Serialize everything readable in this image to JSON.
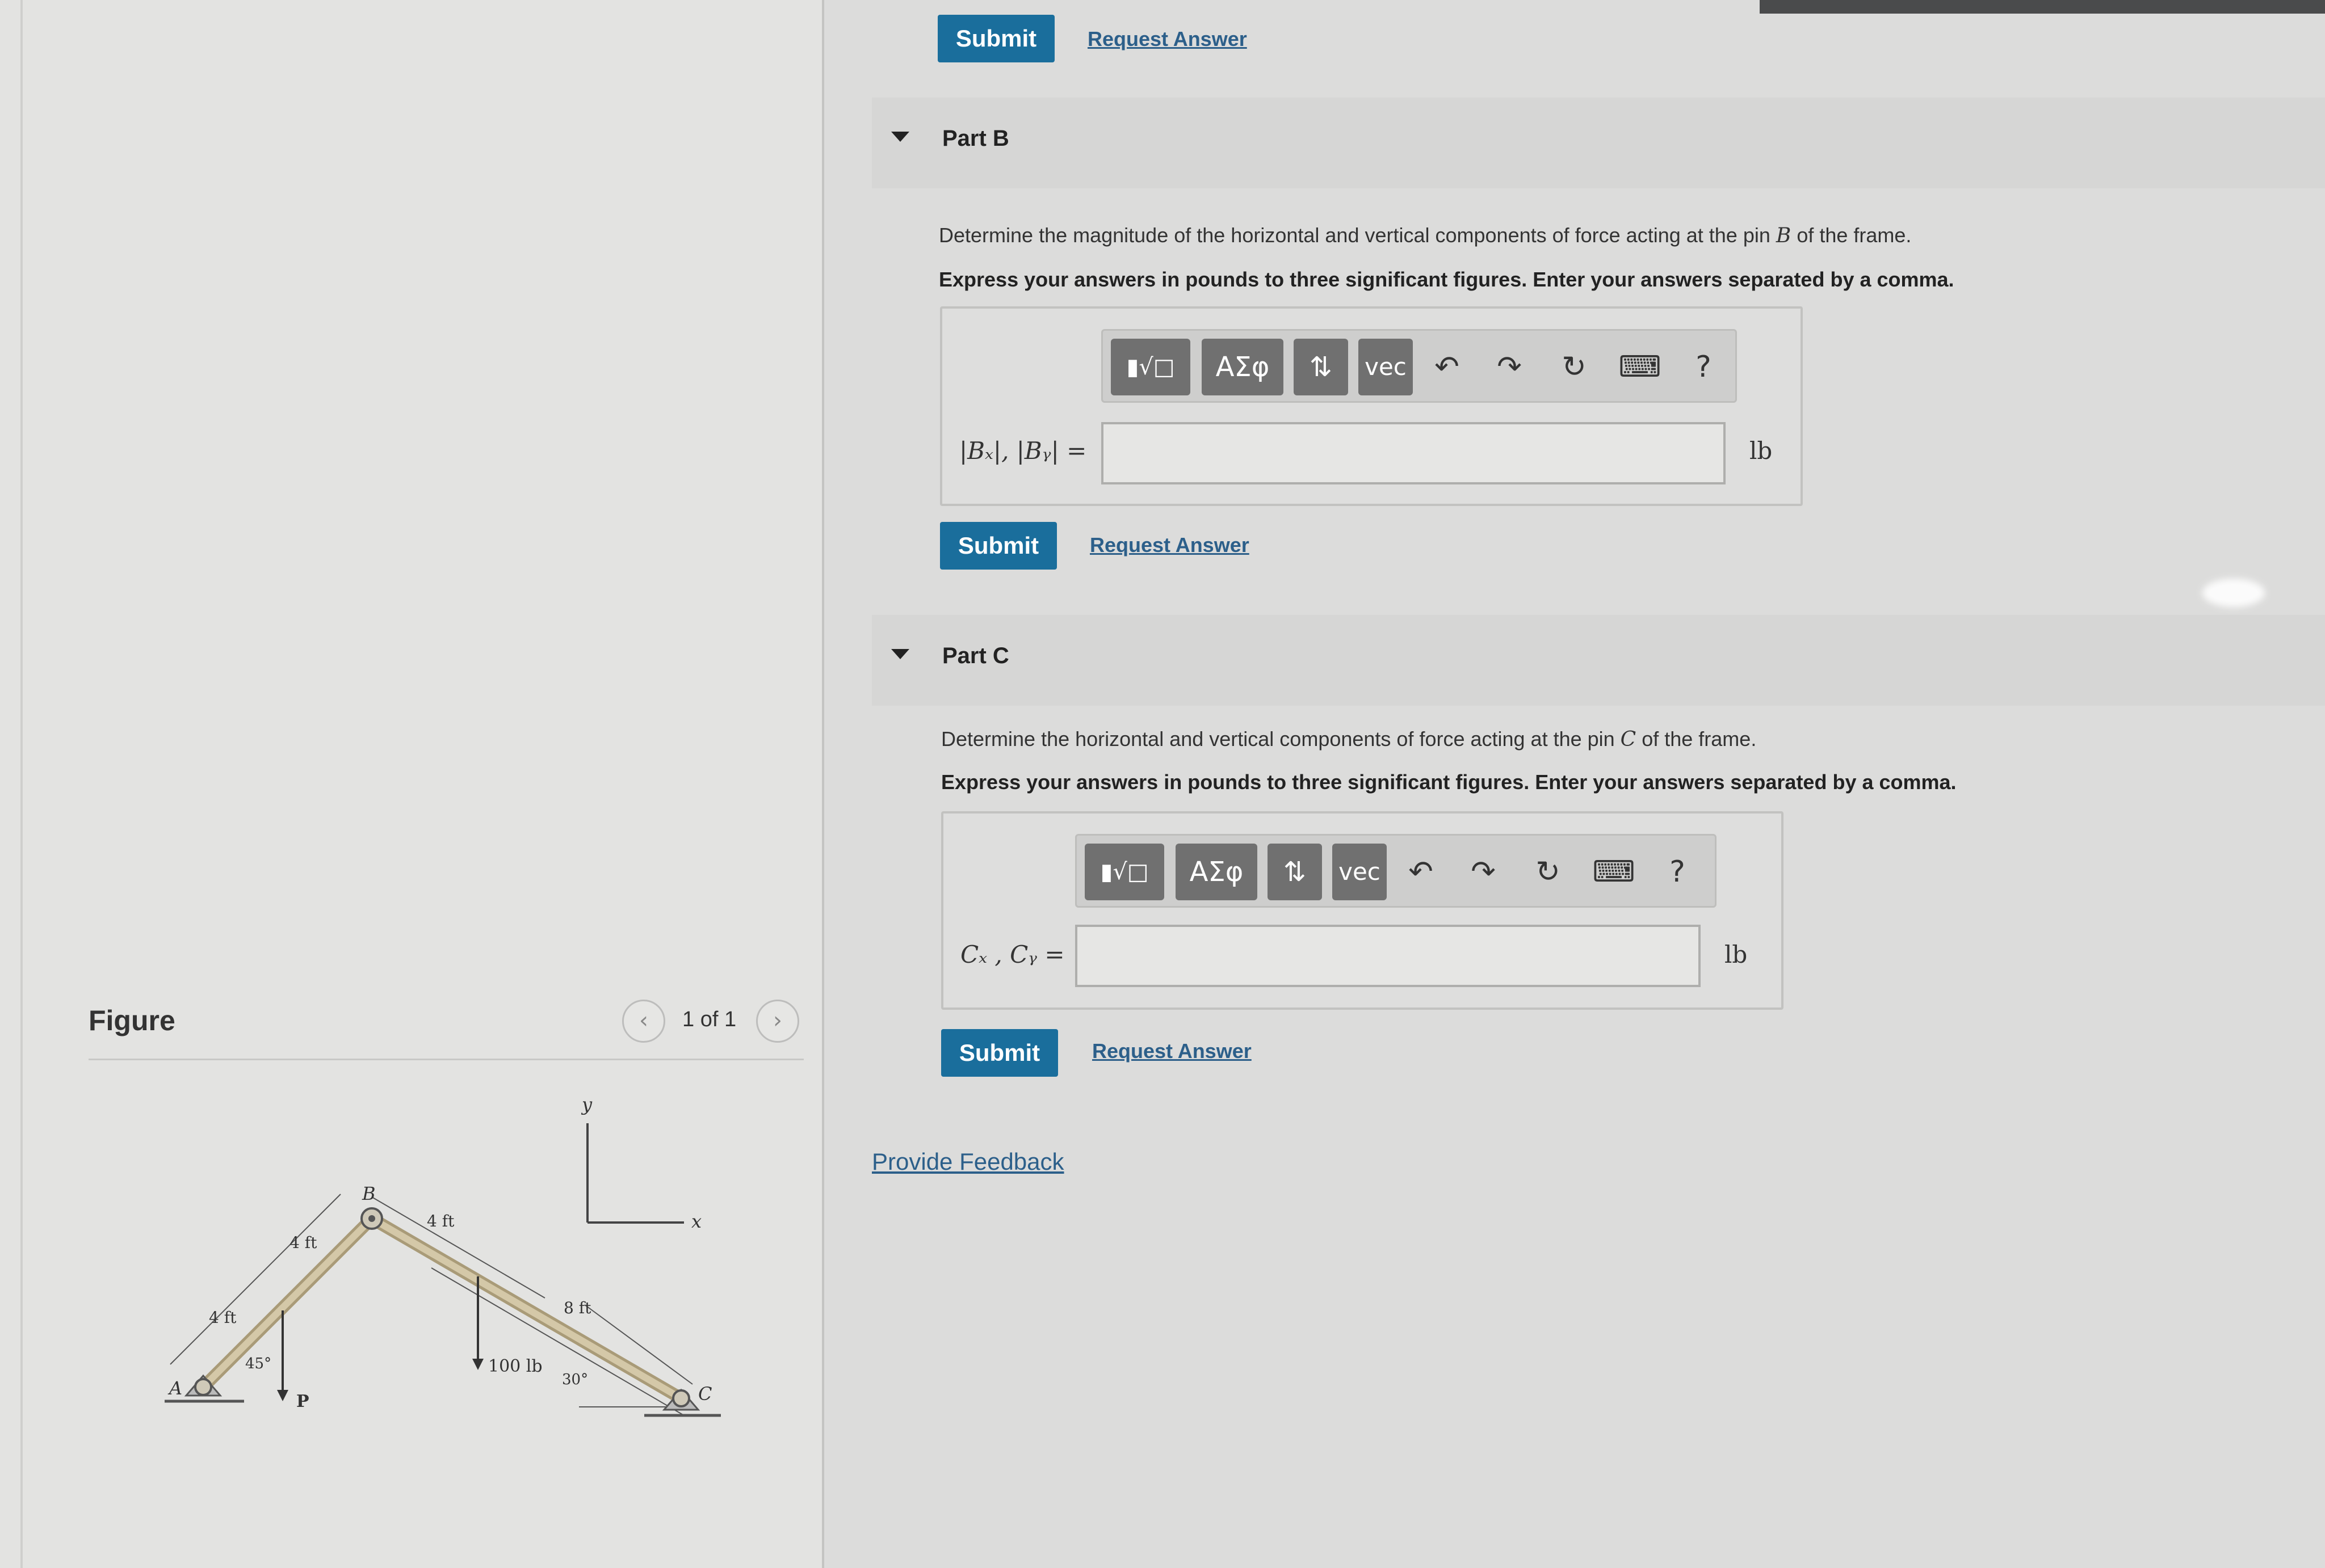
{
  "partA": {
    "submit_label": "Submit",
    "request_answer_label": "Request Answer"
  },
  "partB": {
    "title": "Part B",
    "question_prefix": "Determine the magnitude of the horizontal and vertical components of force acting at the pin ",
    "question_var": "B",
    "question_suffix": " of the frame.",
    "instruction": "Express your answers in pounds to three significant figures. Enter your answers separated by a comma.",
    "toolbar": {
      "template_btn": "▮√□",
      "greek_btn": "ΑΣφ",
      "arrows_btn": "⇅",
      "vec_btn": "vec",
      "undo_icon": "↶",
      "redo_icon": "↷",
      "reset_icon": "↻",
      "keyboard_icon": "⌨",
      "help_icon": "?"
    },
    "answer_label": "|Bₓ|, |Bᵧ| =",
    "answer_value": "",
    "unit": "lb",
    "submit_label": "Submit",
    "request_answer_label": "Request Answer"
  },
  "partC": {
    "title": "Part C",
    "question_prefix": "Determine the horizontal and vertical components of force acting at the pin ",
    "question_var": "C",
    "question_suffix": " of the frame.",
    "instruction": "Express your answers in pounds to three significant figures. Enter your answers separated by a comma.",
    "toolbar": {
      "template_btn": "▮√□",
      "greek_btn": "ΑΣφ",
      "arrows_btn": "⇅",
      "vec_btn": "vec",
      "undo_icon": "↶",
      "redo_icon": "↷",
      "reset_icon": "↻",
      "keyboard_icon": "⌨",
      "help_icon": "?"
    },
    "answer_label": "Cₓ , Cᵧ =",
    "answer_value": "",
    "unit": "lb",
    "submit_label": "Submit",
    "request_answer_label": "Request Answer"
  },
  "feedback_link": "Provide Feedback",
  "figure": {
    "title": "Figure",
    "page_count": "1 of 1",
    "prev_icon": "‹",
    "next_icon": "›",
    "labels": {
      "A": "A",
      "B": "B",
      "C": "C",
      "P": "P",
      "x": "x",
      "y": "y",
      "dim_4ft_a": "4 ft",
      "dim_4ft_b": "4 ft",
      "dim_4ft_c": "4 ft",
      "dim_8ft": "8 ft",
      "angle_45": "45°",
      "angle_30": "30°",
      "load": "100 lb"
    }
  }
}
